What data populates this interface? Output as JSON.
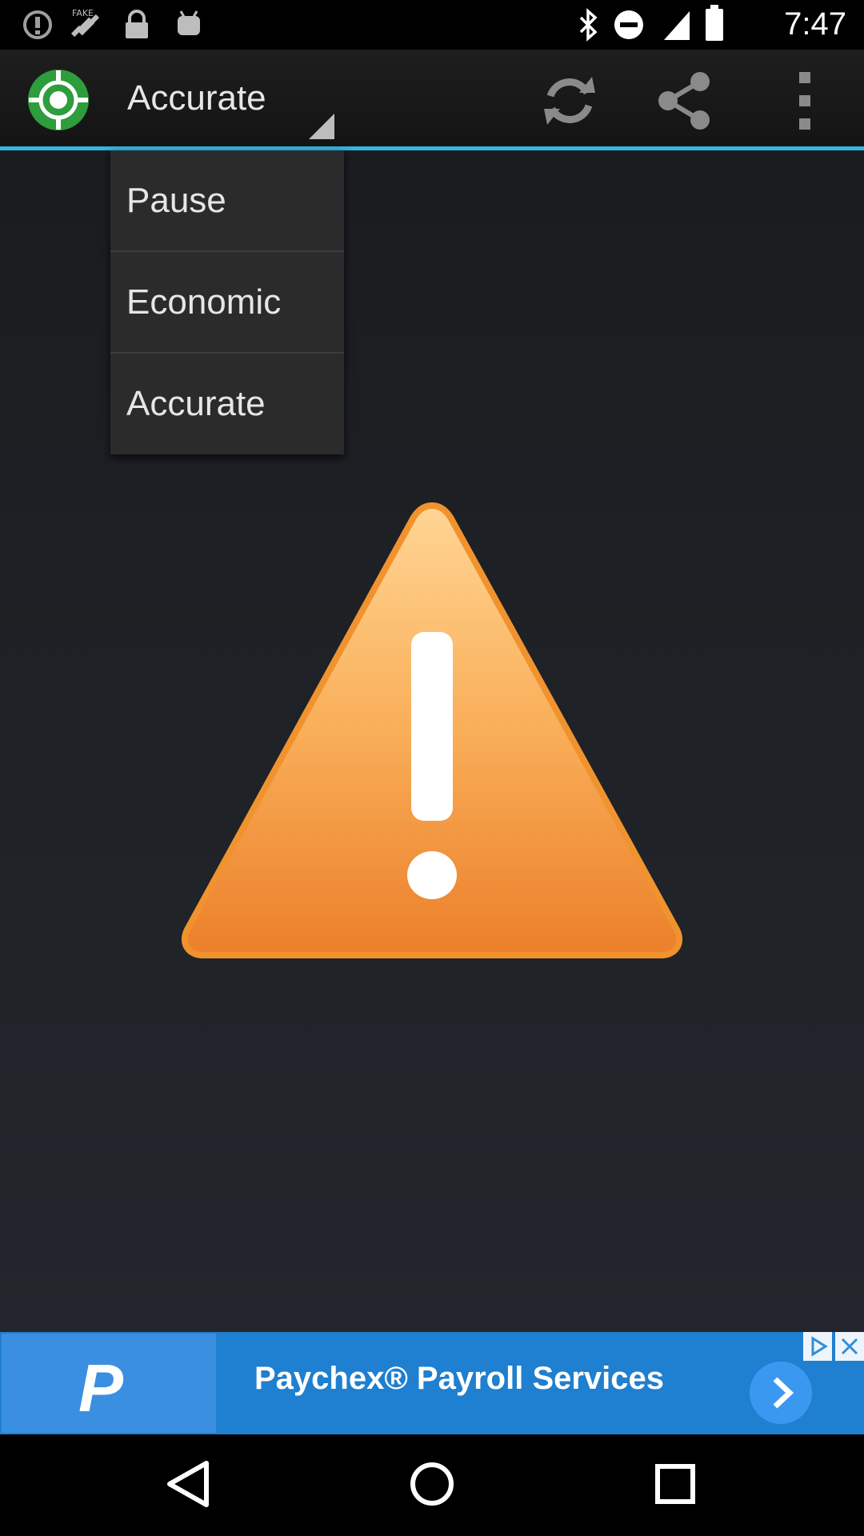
{
  "status_bar": {
    "time": "7:47",
    "icons_left": [
      "alert-circle-icon",
      "fake-gps-satellite-icon",
      "lock-icon",
      "android-icon"
    ],
    "icons_right": [
      "bluetooth-icon",
      "do-not-disturb-icon"
    ]
  },
  "action_bar": {
    "app_icon": "gps-target-icon",
    "spinner_label": "Accurate",
    "actions": [
      "refresh-icon",
      "share-icon",
      "overflow-menu-icon"
    ],
    "accent_color": "#33b5e5"
  },
  "dropdown": {
    "items": [
      {
        "label": "Pause"
      },
      {
        "label": "Economic"
      },
      {
        "label": "Accurate"
      }
    ]
  },
  "main": {
    "warning_icon": "warning-triangle-icon"
  },
  "ad": {
    "logo_letter": "P",
    "text": "Paychex® Payroll Services",
    "brand_color": "#1f7fd0"
  },
  "nav_bar": {
    "buttons": [
      "back-icon",
      "home-icon",
      "recents-icon"
    ]
  }
}
